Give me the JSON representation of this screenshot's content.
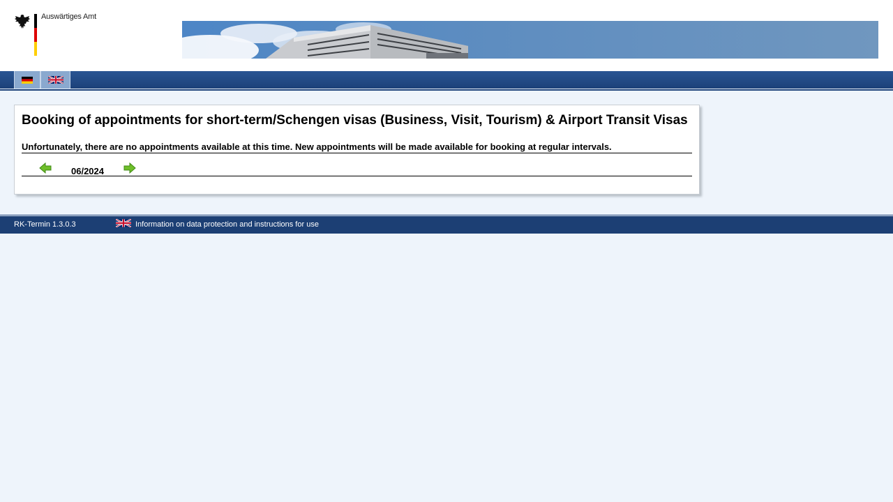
{
  "header": {
    "org_name": "Auswärtiges Amt",
    "icons": {
      "logo": "federal-eagle-icon",
      "banner": "building-banner-image"
    }
  },
  "languages": [
    {
      "code": "de",
      "icon": "flag-germany-icon"
    },
    {
      "code": "en",
      "icon": "flag-uk-icon"
    }
  ],
  "main": {
    "title": "Booking of appointments for short-term/Schengen visas (Business, Visit, Tourism) & Airport Transit Visas",
    "notice": "Unfortunately, there are no appointments available at this time. New appointments will be made available for booking at regular intervals.",
    "month": "06/2024",
    "icons": {
      "prev": "arrow-left-icon",
      "next": "arrow-right-icon"
    }
  },
  "footer": {
    "version": "RK-Termin 1.3.0.3",
    "privacy_link": "Information on data protection and instructions for use",
    "flag_icon": "flag-uk-icon"
  },
  "colors": {
    "nav_blue": "#1c4179",
    "background": "#eef4fb",
    "arrow_green": "#6fbf2a"
  }
}
